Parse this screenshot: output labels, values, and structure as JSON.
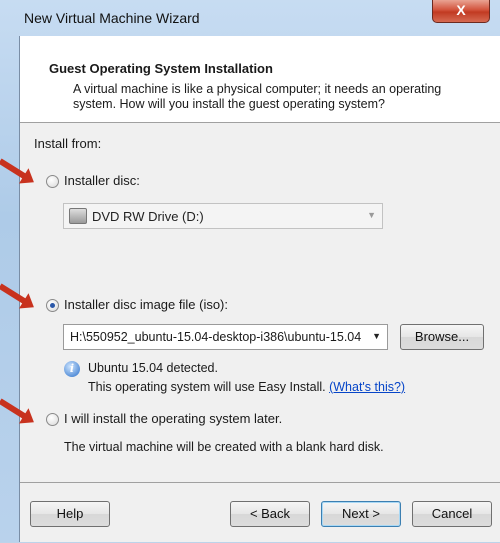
{
  "window": {
    "title": "New Virtual Machine Wizard",
    "close_glyph": "X"
  },
  "header": {
    "title": "Guest Operating System Installation",
    "description": "A virtual machine is like a physical computer; it needs an operating system. How will you install the guest operating system?"
  },
  "install_from": {
    "label": "Install from:",
    "options": [
      {
        "label": "Installer disc:",
        "selected": false
      },
      {
        "label": "Installer disc image file (iso):",
        "selected": true
      },
      {
        "label": "I will install the operating system later.",
        "selected": false
      }
    ],
    "disc_drive": {
      "value": "DVD RW Drive (D:)",
      "icon": "dvd-drive-icon"
    },
    "iso_path": {
      "value": "H:\\550952_ubuntu-15.04-desktop-i386\\ubuntu-15.04",
      "icon": "chevron-down-icon"
    },
    "browse_label": "Browse...",
    "detected_text": "Ubuntu 15.04 detected.",
    "easy_install_text": "This operating system will use Easy Install.",
    "whats_this_link": "(What's this?)",
    "later_note": "The virtual machine will be created with a blank hard disk."
  },
  "footer": {
    "help_label": "Help",
    "back_label": "< Back",
    "next_label": "Next >",
    "cancel_label": "Cancel"
  },
  "colors": {
    "annotation_arrow": "#c8321e",
    "link": "#0645c8"
  }
}
